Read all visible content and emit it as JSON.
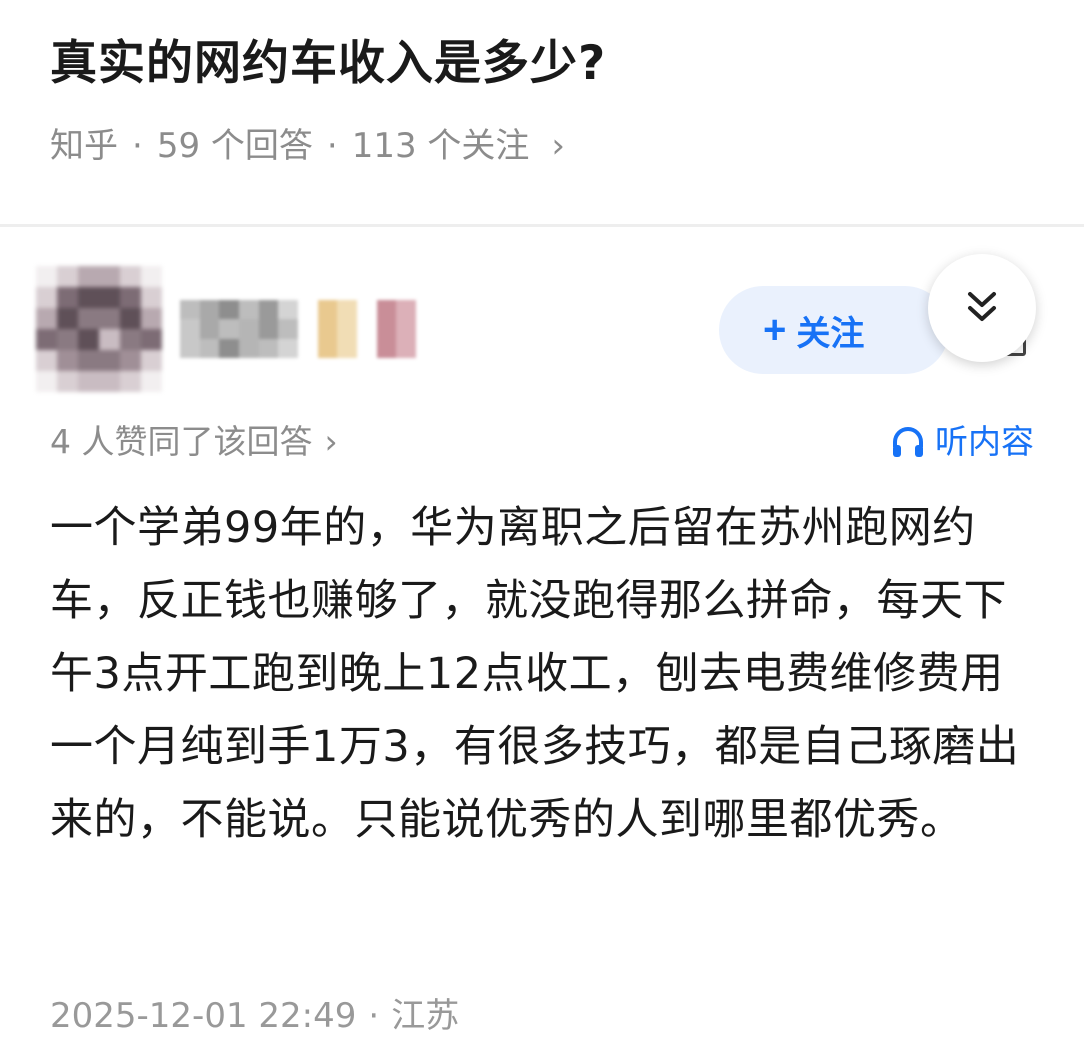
{
  "question": {
    "title": "真实的网约车收入是多少?",
    "source": "知乎",
    "answer_count": "59 个回答",
    "follower_count": "113 个关注",
    "separator": "·",
    "chevron": "›"
  },
  "author": {
    "follow_label": "关注",
    "follow_plus": "+",
    "colors": {
      "follow_bg": "#eaf1fd",
      "follow_text": "#1772f6"
    }
  },
  "answer": {
    "upvote_text": "4 人赞同了该回答",
    "chevron": "›",
    "listen_label": "听内容",
    "content": "一个学弟99年的，华为离职之后留在苏州跑网约车，反正钱也赚够了，就没跑得那么拼命，每天下午3点开工跑到晚上12点收工，刨去电费维修费用一个月纯到手1万3，有很多技巧，都是自己琢磨出来的，不能说。只能说优秀的人到哪里都优秀。",
    "timestamp": "2025-12-01 22:49",
    "separator": "·",
    "location": "江苏"
  }
}
